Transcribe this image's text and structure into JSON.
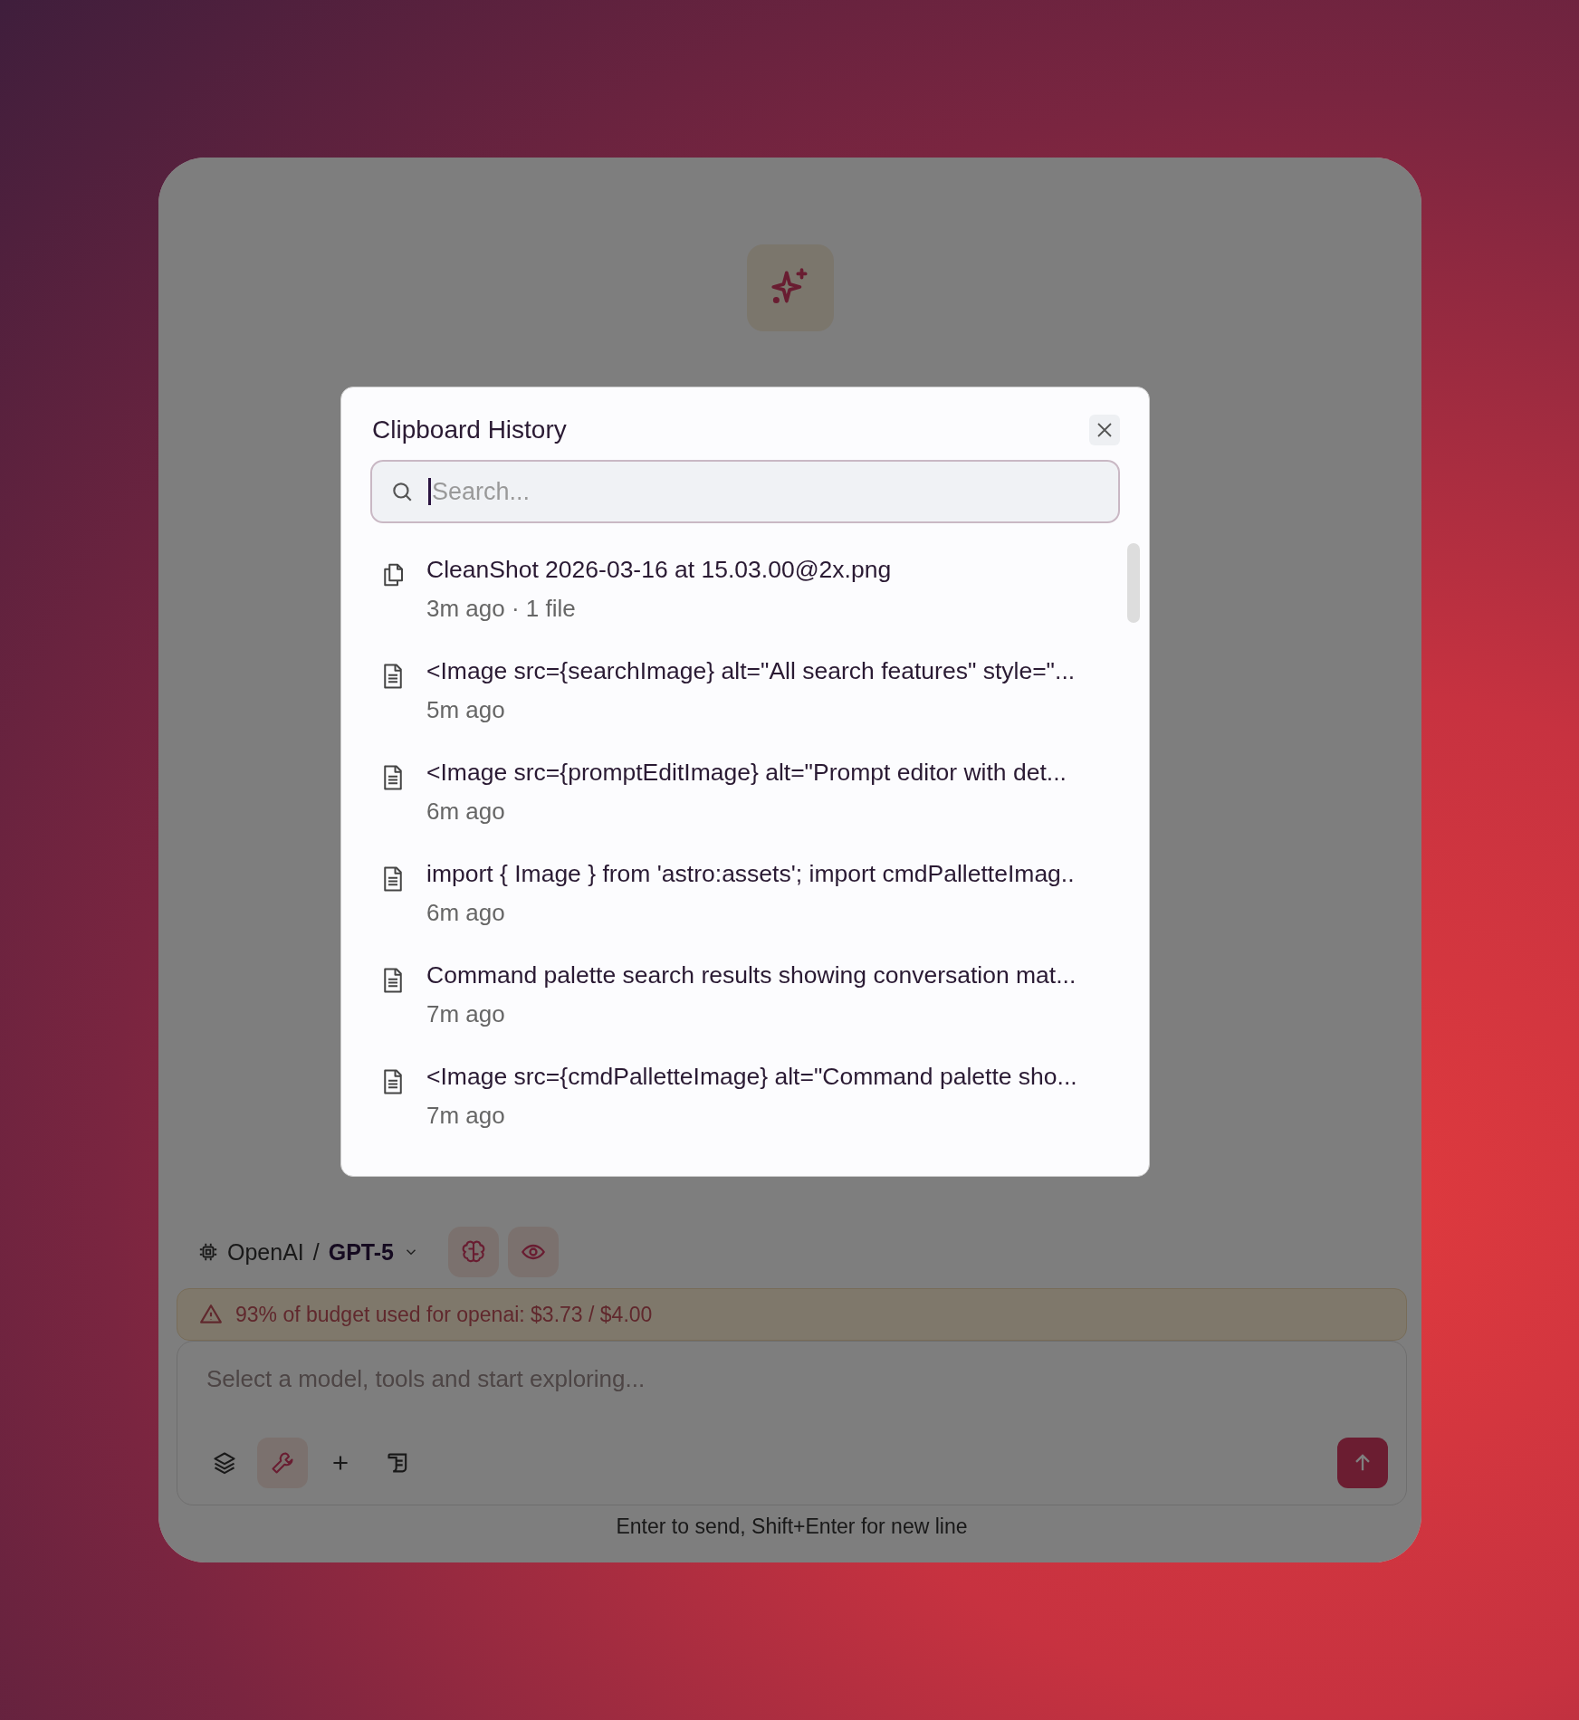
{
  "app": {
    "model": {
      "provider": "OpenAI",
      "separator": "/",
      "name": "GPT-5"
    },
    "toggles": [
      {
        "kind": "brain",
        "on": true
      },
      {
        "kind": "eye",
        "on": true
      }
    ],
    "budget_warning": "93% of budget used for openai: $3.73 / $4.00",
    "composer": {
      "placeholder": "Select a model, tools and start exploring...",
      "tools": [
        {
          "kind": "layers",
          "on": false
        },
        {
          "kind": "wrench",
          "on": true
        },
        {
          "kind": "plus",
          "on": false
        },
        {
          "kind": "scroll",
          "on": false
        }
      ]
    },
    "hint": "Enter to send, Shift+Enter for new line"
  },
  "dialog": {
    "title": "Clipboard History",
    "search": {
      "placeholder": "Search..."
    },
    "items": [
      {
        "kind": "files",
        "text": "CleanShot 2026-03-16 at 15.03.00@2x.png",
        "meta": "3m ago · 1 file"
      },
      {
        "kind": "text",
        "text": "<Image src={searchImage} alt=\"All search features\" style=\"...",
        "meta": "5m ago"
      },
      {
        "kind": "text",
        "text": "<Image src={promptEditImage} alt=\"Prompt editor with det...",
        "meta": "6m ago"
      },
      {
        "kind": "text",
        "text": "import { Image } from 'astro:assets'; import cmdPalletteImag..",
        "meta": "6m ago"
      },
      {
        "kind": "text",
        "text": "Command palette search results showing conversation mat...",
        "meta": "7m ago"
      },
      {
        "kind": "text",
        "text": "<Image src={cmdPalletteImage} alt=\"Command palette sho...",
        "meta": "7m ago"
      }
    ]
  }
}
